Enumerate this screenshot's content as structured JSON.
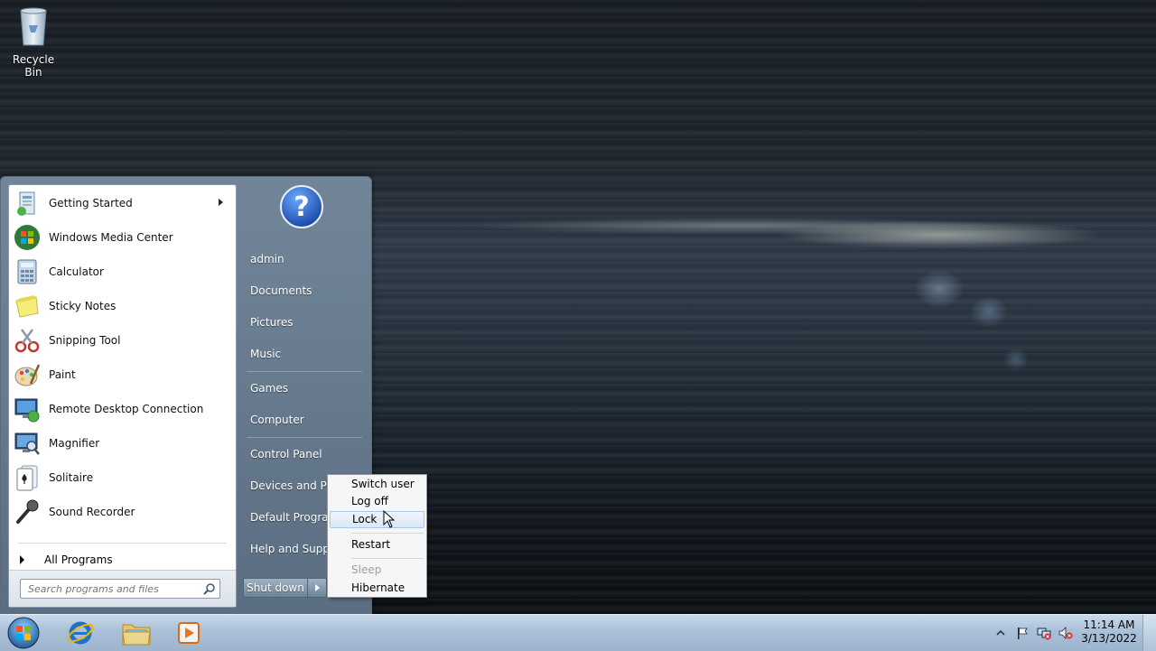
{
  "desktop": {
    "icons": [
      {
        "label": "Recycle Bin",
        "icon": "recycle-bin-icon"
      }
    ]
  },
  "start_menu": {
    "programs": [
      {
        "label": "Getting Started",
        "icon": "getting-started-icon",
        "has_submenu": true
      },
      {
        "label": "Windows Media Center",
        "icon": "windows-media-center-icon"
      },
      {
        "label": "Calculator",
        "icon": "calculator-icon"
      },
      {
        "label": "Sticky Notes",
        "icon": "sticky-notes-icon"
      },
      {
        "label": "Snipping Tool",
        "icon": "snipping-tool-icon"
      },
      {
        "label": "Paint",
        "icon": "paint-icon"
      },
      {
        "label": "Remote Desktop Connection",
        "icon": "remote-desktop-icon"
      },
      {
        "label": "Magnifier",
        "icon": "magnifier-icon"
      },
      {
        "label": "Solitaire",
        "icon": "solitaire-icon"
      },
      {
        "label": "Sound Recorder",
        "icon": "sound-recorder-icon"
      }
    ],
    "all_programs": "All Programs",
    "search_placeholder": "Search programs and files",
    "right_items": [
      {
        "label": "admin"
      },
      {
        "label": "Documents"
      },
      {
        "label": "Pictures"
      },
      {
        "label": "Music"
      },
      {
        "label": "Games"
      },
      {
        "label": "Computer"
      },
      {
        "label": "Control Panel"
      },
      {
        "label": "Devices and Prin"
      },
      {
        "label": "Default Program"
      },
      {
        "label": "Help and Suppo"
      }
    ],
    "shutdown_label": "Shut down"
  },
  "power_menu": {
    "items": [
      {
        "label": "Switch user",
        "state": "normal"
      },
      {
        "label": "Log off",
        "state": "normal"
      },
      {
        "label": "Lock",
        "state": "hover"
      },
      {
        "label": "Restart",
        "state": "normal"
      },
      {
        "label": "Sleep",
        "state": "disabled"
      },
      {
        "label": "Hibernate",
        "state": "normal"
      }
    ]
  },
  "taskbar": {
    "pinned": [
      {
        "name": "internet-explorer",
        "icon": "internet-explorer-icon"
      },
      {
        "name": "windows-explorer",
        "icon": "folder-icon"
      },
      {
        "name": "media-player",
        "icon": "media-player-icon"
      }
    ],
    "clock": {
      "time": "11:14 AM",
      "date": "3/13/2022"
    }
  },
  "colors": {
    "taskbar": "#a9c0d8",
    "start_menu_right": "#7f95ab",
    "hover_highlight": "#dbe8f7"
  }
}
